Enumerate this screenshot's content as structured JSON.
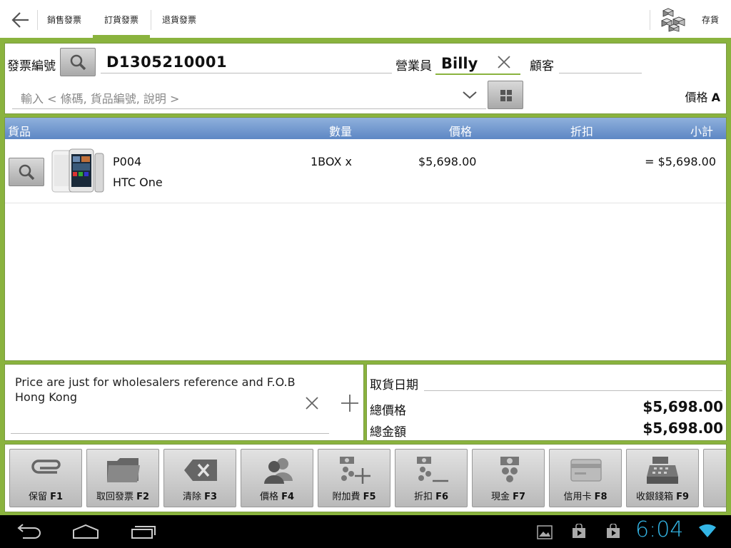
{
  "tabs": [
    {
      "label": "銷售發票"
    },
    {
      "label": "訂貨發票"
    },
    {
      "label": "退貨發票"
    }
  ],
  "active_tab_index": 1,
  "store_label": "存貨",
  "header": {
    "invoice_no_label": "發票編號",
    "invoice_no": "D1305210001",
    "salesman_label": "營業員",
    "salesman": "Billy",
    "customer_label": "顧客",
    "customer": "",
    "item_input_placeholder": "輸入 < 條碼, 貨品編號, 說明 >",
    "price_level_label": "價格",
    "price_level": "A"
  },
  "table": {
    "columns": [
      "貨品",
      "數量",
      "價格",
      "折扣",
      "小計"
    ],
    "rows": [
      {
        "code": "P004",
        "name": "HTC One",
        "qty": "1BOX x",
        "price": "$5,698.00",
        "discount": "",
        "subtotal": "= $5,698.00"
      }
    ]
  },
  "notes": "Price are just for wholesalers reference and F.O.B Hong Kong",
  "totals": {
    "pickup_date_label": "取貨日期",
    "pickup_date": "",
    "total_price_label": "總價格",
    "total_price": "$5,698.00",
    "total_amount_label": "總金額",
    "total_amount": "$5,698.00"
  },
  "function_buttons": [
    {
      "label": "保留",
      "key": "F1",
      "icon": "paperclip-icon"
    },
    {
      "label": "取回發票",
      "key": "F2",
      "icon": "folder-icon"
    },
    {
      "label": "清除",
      "key": "F3",
      "icon": "backspace-icon"
    },
    {
      "label": "價格",
      "key": "F4",
      "icon": "users-icon"
    },
    {
      "label": "附加費",
      "key": "F5",
      "icon": "surcharge-icon"
    },
    {
      "label": "折扣",
      "key": "F6",
      "icon": "discount-icon"
    },
    {
      "label": "現金",
      "key": "F7",
      "icon": "cash-icon"
    },
    {
      "label": "信用卡",
      "key": "F8",
      "icon": "credit-card-icon"
    },
    {
      "label": "收銀錢箱",
      "key": "F9",
      "icon": "cash-register-icon"
    }
  ],
  "status_bar": {
    "time": "6:04"
  },
  "colors": {
    "accent": "#8ab33e",
    "table_header": "#5d87c4",
    "clock": "#33b5e5"
  }
}
